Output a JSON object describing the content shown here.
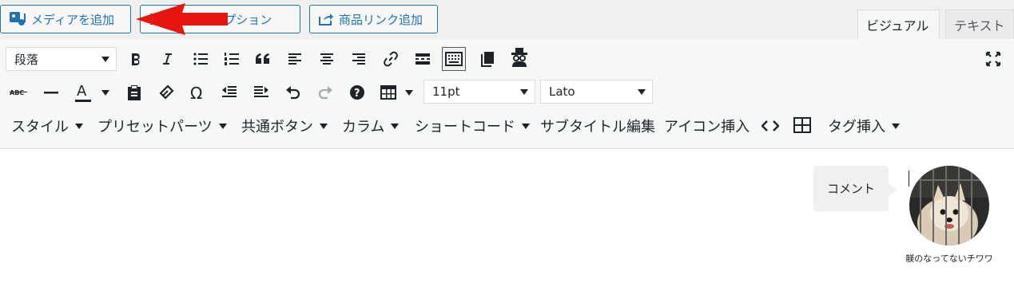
{
  "media_buttons": {
    "add_media": "メディアを追加",
    "icon_option": "アイコンオプション",
    "add_product_link": "商品リンク追加"
  },
  "editor_tabs": {
    "visual": "ビジュアル",
    "text": "テキスト"
  },
  "toolbar": {
    "format_select": "段落",
    "font_size_select": "11pt",
    "font_family_select": "Lato",
    "menus": [
      "スタイル",
      "プリセットパーツ",
      "共通ボタン",
      "カラム",
      "ショートコード",
      "サブタイトル編集",
      "アイコン挿入",
      "タグ挿入"
    ]
  },
  "content": {
    "speech_bubble": "コメント",
    "avatar_name": "躾のなってないチワワ"
  },
  "colors": {
    "accent": "#2271b1",
    "arrow": "#e8140e"
  }
}
